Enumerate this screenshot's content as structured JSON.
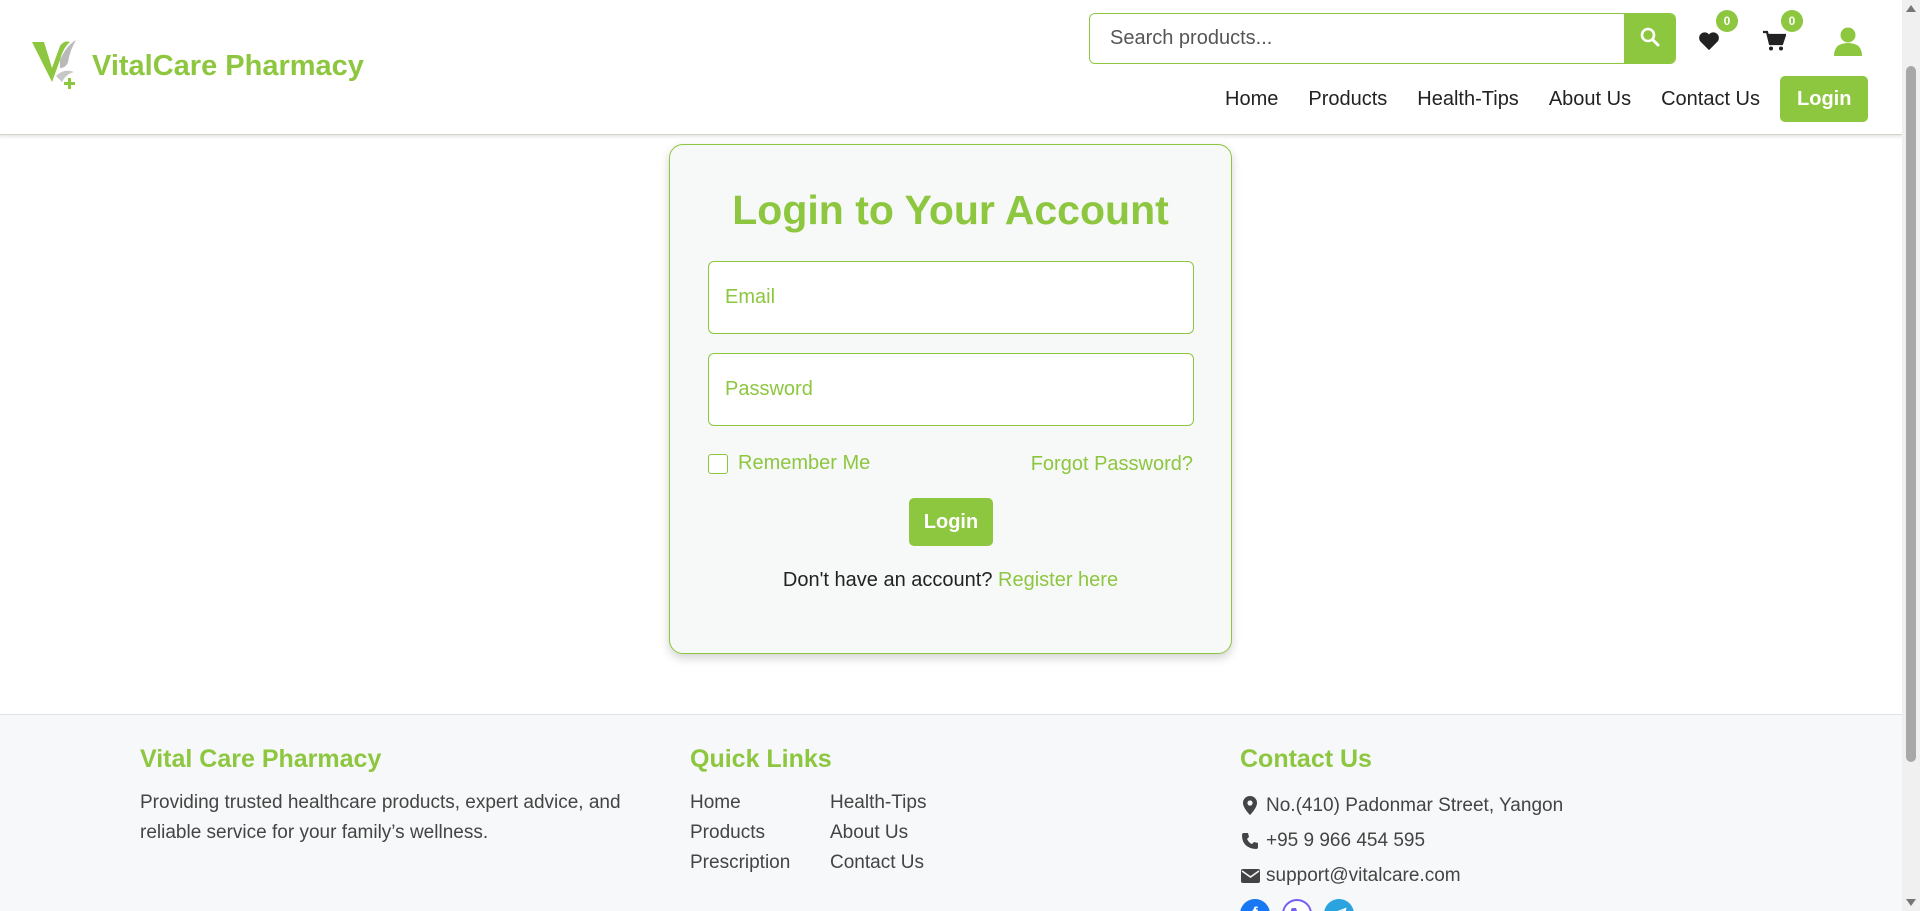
{
  "header": {
    "brand_name": "VitalCare Pharmacy",
    "search": {
      "placeholder": "Search products..."
    },
    "wishlist_count": "0",
    "cart_count": "0",
    "nav": [
      {
        "label": "Home"
      },
      {
        "label": "Products"
      },
      {
        "label": "Health-Tips"
      },
      {
        "label": "About Us"
      },
      {
        "label": "Contact Us"
      }
    ],
    "login_label": "Login"
  },
  "login_card": {
    "title": "Login to Your Account",
    "email_placeholder": "Email",
    "password_placeholder": "Password",
    "remember_label": "Remember Me",
    "forgot_label": "Forgot Password?",
    "submit_label": "Login",
    "no_account_text": "Don't have an account?",
    "register_label": "Register here"
  },
  "footer": {
    "about": {
      "heading": "Vital Care Pharmacy",
      "text": "Providing trusted healthcare products, expert advice, and reliable service for your family’s wellness."
    },
    "quick_links": {
      "heading": "Quick Links",
      "items": [
        "Home",
        "Health-Tips",
        "Products",
        "About Us",
        "Prescription",
        "Contact Us"
      ]
    },
    "contact": {
      "heading": "Contact Us",
      "address": "No.(410) Padonmar Street, Yangon",
      "phone": "+95 9 966 454 595",
      "email": "support@vitalcare.com"
    }
  },
  "colors": {
    "accent": "#8dc63f",
    "facebook": "#1877f2",
    "viber": "#7360f2",
    "telegram": "#2aa3df"
  }
}
